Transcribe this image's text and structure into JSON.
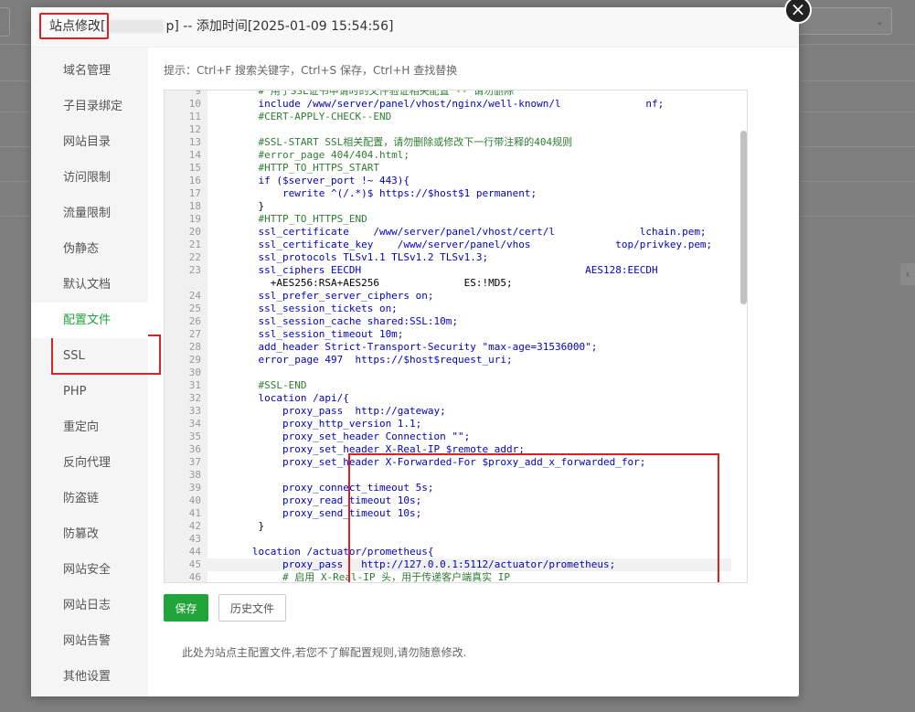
{
  "background": {
    "select_label": "类"
  },
  "modal": {
    "title_prefix": "站点修改[",
    "title_suffix": "p] -- 添加时间[2025-01-09 15:54:56]",
    "close_symbol": "×"
  },
  "sidebar": {
    "items": [
      {
        "label": "域名管理",
        "active": false
      },
      {
        "label": "子目录绑定",
        "active": false
      },
      {
        "label": "网站目录",
        "active": false
      },
      {
        "label": "访问限制",
        "active": false
      },
      {
        "label": "流量限制",
        "active": false
      },
      {
        "label": "伪静态",
        "active": false
      },
      {
        "label": "默认文档",
        "active": false
      },
      {
        "label": "配置文件",
        "active": true
      },
      {
        "label": "SSL",
        "active": false
      },
      {
        "label": "PHP",
        "active": false
      },
      {
        "label": "重定向",
        "active": false
      },
      {
        "label": "反向代理",
        "active": false
      },
      {
        "label": "防盗链",
        "active": false
      },
      {
        "label": "防篡改",
        "active": false
      },
      {
        "label": "网站安全",
        "active": false
      },
      {
        "label": "网站日志",
        "active": false
      },
      {
        "label": "网站告警",
        "active": false
      },
      {
        "label": "其他设置",
        "active": false
      }
    ]
  },
  "hint": "提示：Ctrl+F 搜索关键字，Ctrl+S 保存，Ctrl+H 查找替换",
  "editor": {
    "lines": [
      {
        "n": "9",
        "t": "    # 用于SSL证书申请时的文件验证相关配置 -- 请勿删除"
      },
      {
        "n": "10",
        "t": "    include /www/server/panel/vhost/nginx/well-known/l              nf;"
      },
      {
        "n": "11",
        "t": "    #CERT-APPLY-CHECK--END"
      },
      {
        "n": "12",
        "t": ""
      },
      {
        "n": "13",
        "t": "    #SSL-START SSL相关配置，请勿删除或修改下一行带注释的404规则"
      },
      {
        "n": "14",
        "t": "    #error_page 404/404.html;"
      },
      {
        "n": "15",
        "t": "    #HTTP_TO_HTTPS_START"
      },
      {
        "n": "16",
        "t": "    if ($server_port !~ 443){"
      },
      {
        "n": "17",
        "t": "        rewrite ^(/.*)$ https://$host$1 permanent;"
      },
      {
        "n": "18",
        "t": "    }"
      },
      {
        "n": "19",
        "t": "    #HTTP_TO_HTTPS_END"
      },
      {
        "n": "20",
        "t": "    ssl_certificate    /www/server/panel/vhost/cert/l              lchain.pem;"
      },
      {
        "n": "21",
        "t": "    ssl_certificate_key    /www/server/panel/vhos              top/privkey.pem;"
      },
      {
        "n": "22",
        "t": "    ssl_protocols TLSv1.1 TLSv1.2 TLSv1.3;"
      },
      {
        "n": "23",
        "t": "    ssl_ciphers EECDH                                     AES128:EECDH"
      },
      {
        "n": "",
        "t": "      +AES256:RSA+AES256              ES:!MD5;"
      },
      {
        "n": "24",
        "t": "    ssl_prefer_server_ciphers on;"
      },
      {
        "n": "25",
        "t": "    ssl_session_tickets on;"
      },
      {
        "n": "26",
        "t": "    ssl_session_cache shared:SSL:10m;"
      },
      {
        "n": "27",
        "t": "    ssl_session_timeout 10m;"
      },
      {
        "n": "28",
        "t": "    add_header Strict-Transport-Security \"max-age=31536000\";"
      },
      {
        "n": "29",
        "t": "    error_page 497  https://$host$request_uri;"
      },
      {
        "n": "30",
        "t": ""
      },
      {
        "n": "31",
        "t": "    #SSL-END"
      },
      {
        "n": "32",
        "t": "    location /api/{"
      },
      {
        "n": "33",
        "t": "        proxy_pass  http://gateway;"
      },
      {
        "n": "34",
        "t": "        proxy_http_version 1.1;"
      },
      {
        "n": "35",
        "t": "        proxy_set_header Connection \"\";"
      },
      {
        "n": "36",
        "t": "        proxy_set_header X-Real-IP $remote_addr;"
      },
      {
        "n": "37",
        "t": "        proxy_set_header X-Forwarded-For $proxy_add_x_forwarded_for;"
      },
      {
        "n": "38",
        "t": ""
      },
      {
        "n": "39",
        "t": "        proxy_connect_timeout 5s;"
      },
      {
        "n": "40",
        "t": "        proxy_read_timeout 10s;"
      },
      {
        "n": "41",
        "t": "        proxy_send_timeout 10s;"
      },
      {
        "n": "42",
        "t": "    }"
      },
      {
        "n": "43",
        "t": ""
      },
      {
        "n": "44",
        "t": "   location /actuator/prometheus{"
      },
      {
        "n": "45",
        "t": "        proxy_pass   http://127.0.0.1:5112/actuator/prometheus;"
      },
      {
        "n": "46",
        "t": "        # 启用 X-Real-IP 头，用于传递客户端真实 IP"
      }
    ]
  },
  "buttons": {
    "save": "保存",
    "history": "历史文件"
  },
  "note": "此处为站点主配置文件,若您不了解配置规则,请勿随意修改."
}
